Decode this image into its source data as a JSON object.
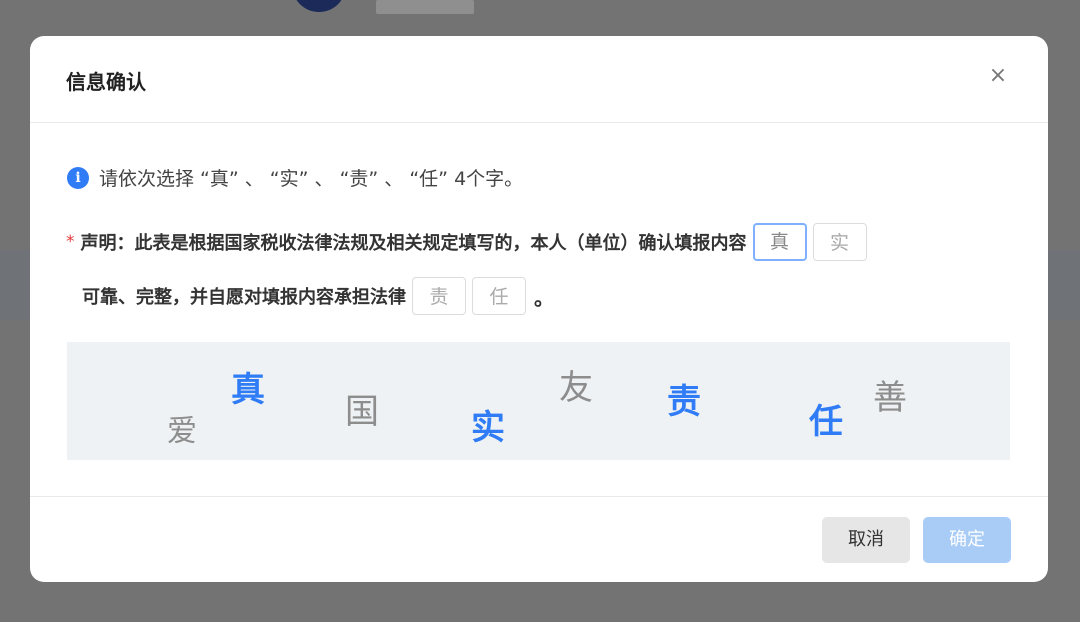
{
  "dialog": {
    "title": "信息确认",
    "close_glyph": "×",
    "tip_icon_glyph": "i",
    "tip_text": "请依次选择 “真” 、 “实” 、 “责” 、 “任” 4个字。",
    "required_mark": "*",
    "statement_line1": "声明：此表是根据国家税收法律法规及相关规定填写的，本人（单位）确认填报内容",
    "statement_line2": "可靠、完整，并自愿对填报内容承担法律",
    "period": "。",
    "slots": [
      "真",
      "实",
      "责",
      "任"
    ],
    "active_slot": 0,
    "captcha": {
      "chars": [
        {
          "text": "真",
          "kind": "target"
        },
        {
          "text": "爱",
          "kind": "decoy"
        },
        {
          "text": "国",
          "kind": "decoy"
        },
        {
          "text": "友",
          "kind": "decoy"
        },
        {
          "text": "实",
          "kind": "target"
        },
        {
          "text": "责",
          "kind": "target"
        },
        {
          "text": "任",
          "kind": "target"
        },
        {
          "text": "善",
          "kind": "decoy"
        }
      ]
    },
    "cancel_label": "取消",
    "ok_label": "确定",
    "colors": {
      "accent": "#2f7cf6",
      "ok_disabled": "#a9ccf7",
      "required": "#e23b3b"
    }
  }
}
